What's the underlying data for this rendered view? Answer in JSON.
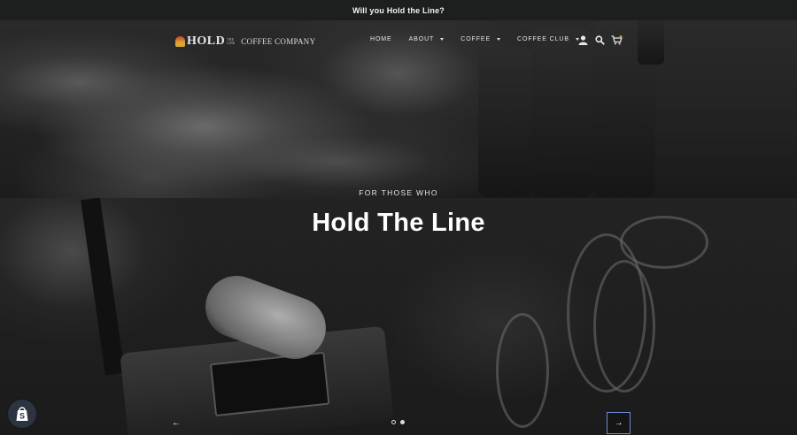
{
  "announcement": {
    "text": "Will you Hold the Line?"
  },
  "brand": {
    "name": "HOLD",
    "tagline_small": "THE LINE",
    "company": "COFFEE COMPANY",
    "accent": "#d23b2a",
    "gold": "#d8a832"
  },
  "nav": {
    "items": [
      {
        "label": "HOME",
        "has_dropdown": false
      },
      {
        "label": "ABOUT",
        "has_dropdown": true
      },
      {
        "label": "COFFEE",
        "has_dropdown": true
      },
      {
        "label": "COFFEE CLUB",
        "has_dropdown": true
      }
    ],
    "icons": [
      "account-icon",
      "search-icon",
      "cart-icon"
    ],
    "cart_badge_color": "#d8a832"
  },
  "hero": {
    "eyebrow": "FOR THOSE WHO",
    "headline": "Hold The Line"
  },
  "slideshow": {
    "prev_symbol": "←",
    "next_symbol": "→",
    "slide_count": 2,
    "active_slide": 2,
    "focus_color": "#6a8bd6"
  },
  "widgets": {
    "shopify": "shopify-bag-icon"
  }
}
